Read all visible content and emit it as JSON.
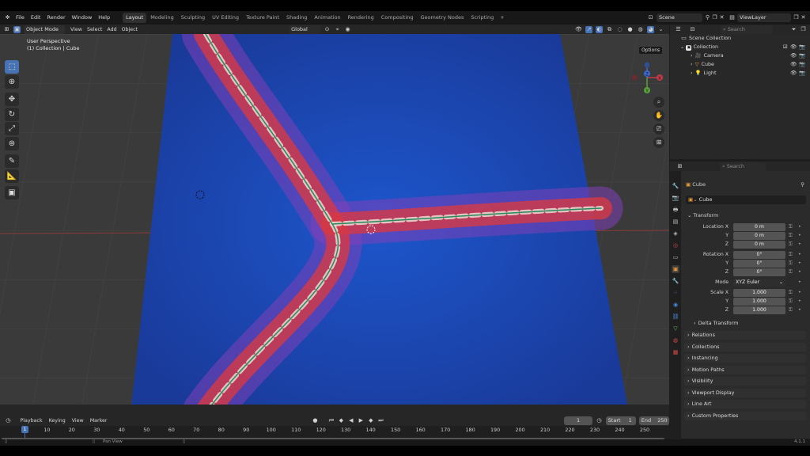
{
  "menu": [
    "File",
    "Edit",
    "Render",
    "Window",
    "Help"
  ],
  "workspaces": [
    "Layout",
    "Modeling",
    "Sculpting",
    "UV Editing",
    "Texture Paint",
    "Shading",
    "Animation",
    "Rendering",
    "Compositing",
    "Geometry Nodes",
    "Scripting"
  ],
  "active_workspace": "Layout",
  "add_workspace": "+",
  "scene": "Scene",
  "view_layer": "ViewLayer",
  "viewport_header": {
    "mode": "Object Mode",
    "menus": [
      "View",
      "Select",
      "Add",
      "Object"
    ],
    "orientation": "Global",
    "options": "Options"
  },
  "viewport": {
    "perspective": "User Perspective",
    "collection_info": "(1) Collection | Cube",
    "gizmo_axes": [
      "X",
      "Y",
      "Z"
    ]
  },
  "outliner": {
    "search_placeholder": "Search",
    "root": "Scene Collection",
    "collection": "Collection",
    "items": [
      "Camera",
      "Cube",
      "Light"
    ]
  },
  "properties": {
    "search_placeholder": "Search",
    "object_name": "Cube",
    "data_name": "Cube",
    "transform_label": "Transform",
    "location_label": "Location X",
    "rotation_label": "Rotation X",
    "scale_label": "Scale X",
    "y_label": "Y",
    "z_label": "Z",
    "location": [
      "0 m",
      "0 m",
      "0 m"
    ],
    "rotation": [
      "0°",
      "0°",
      "0°"
    ],
    "mode_label": "Mode",
    "mode_value": "XYZ Euler",
    "scale": [
      "1.000",
      "1.000",
      "1.000"
    ],
    "panels": [
      "Delta Transform",
      "Relations",
      "Collections",
      "Instancing",
      "Motion Paths",
      "Visibility",
      "Viewport Display",
      "Line Art",
      "Custom Properties"
    ]
  },
  "timeline": {
    "menus": [
      "Playback",
      "Keying",
      "View",
      "Marker"
    ],
    "current_frame": "1",
    "start_label": "Start",
    "start": "1",
    "end_label": "End",
    "end": "250",
    "ticks": [
      "1",
      "10",
      "20",
      "30",
      "40",
      "50",
      "60",
      "70",
      "80",
      "90",
      "100",
      "110",
      "120",
      "130",
      "140",
      "150",
      "160",
      "170",
      "180",
      "190",
      "200",
      "210",
      "220",
      "230",
      "240",
      "250"
    ]
  },
  "status": {
    "hint": "Pan View",
    "version": "4.1.1"
  }
}
